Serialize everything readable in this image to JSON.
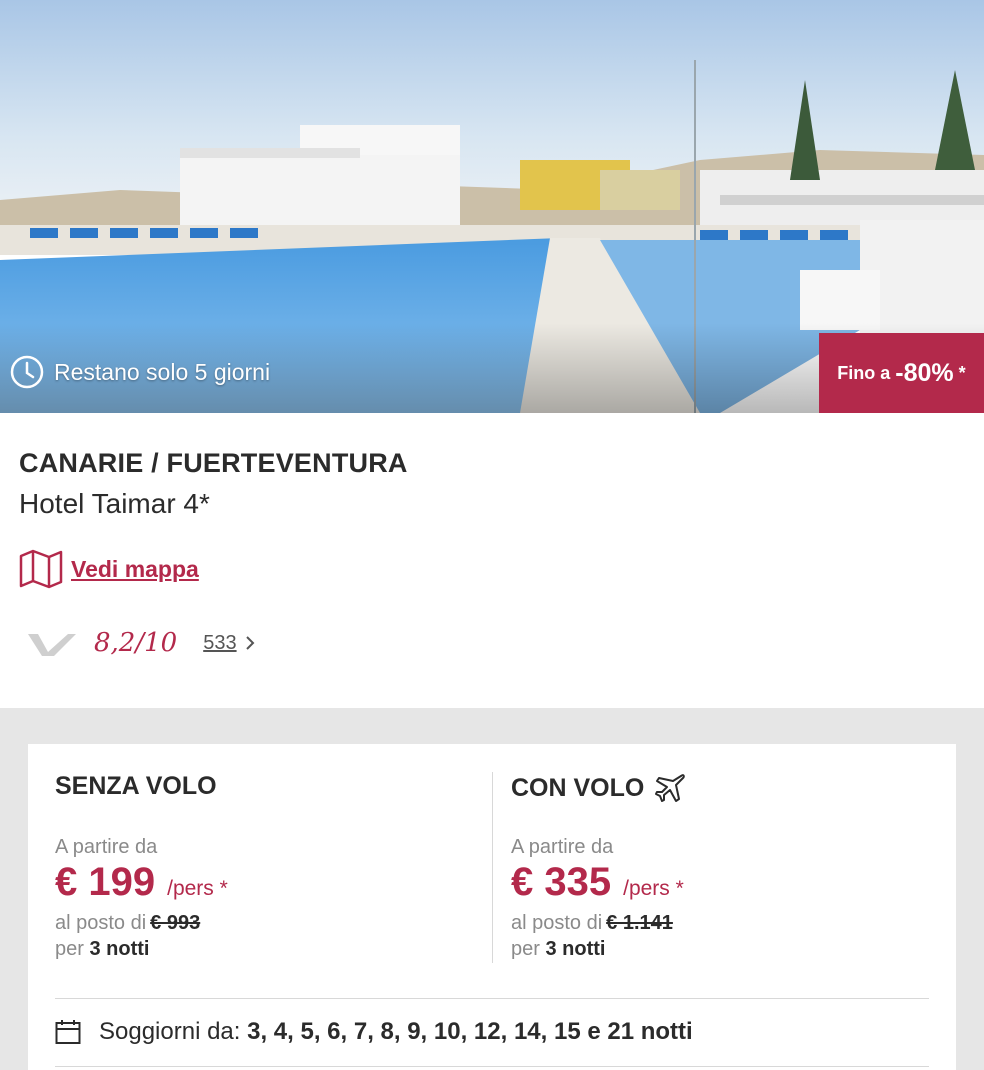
{
  "hero": {
    "countdown_text": "Restano solo 5 giorni",
    "discount_prefix": "Fino a",
    "discount_value": "-80%",
    "discount_mark": "*",
    "icon": "clock-icon"
  },
  "hotel": {
    "region": "CANARIE / FUERTEVENTURA",
    "name": "Hotel Taimar 4*",
    "map_link": "Vedi mappa",
    "map_icon": "map-icon"
  },
  "rating": {
    "score": "8,2/10",
    "reviews_count": "533"
  },
  "offers": {
    "without_flight": {
      "title": "SENZA VOLO",
      "from_label": "A partire da",
      "price": "€ 199",
      "per": "/pers *",
      "old_label": "al posto di",
      "old_price": "€ 993",
      "nights_label": "per",
      "nights_value": "3 notti"
    },
    "with_flight": {
      "title": "CON VOLO",
      "from_label": "A partire da",
      "price": "€ 335",
      "per": "/pers *",
      "old_label": "al posto di",
      "old_price": "€ 1.141",
      "nights_label": "per",
      "nights_value": "3 notti",
      "icon": "plane-icon"
    }
  },
  "stays": {
    "label": "Soggiorni da:",
    "values": "3, 4, 5, 6, 7, 8, 9, 10, 12, 14, 15 e 21 notti",
    "icon": "calendar-icon"
  },
  "colors": {
    "accent": "#b3294b",
    "muted": "#8a8a8a",
    "background_gray": "#e6e6e6"
  }
}
